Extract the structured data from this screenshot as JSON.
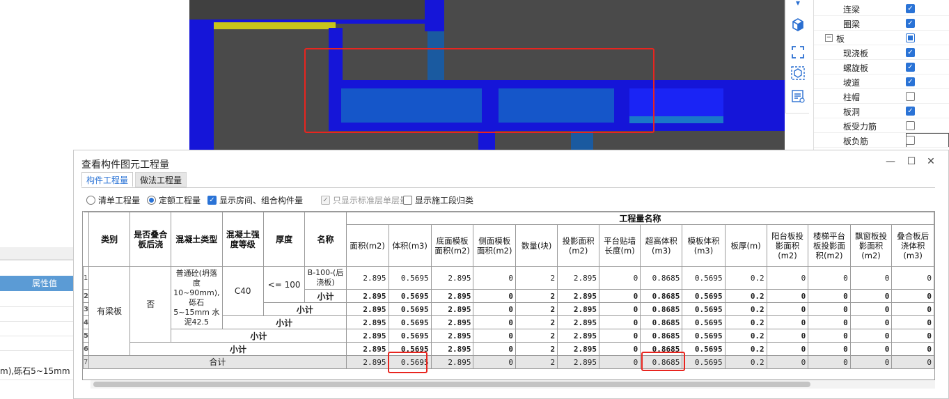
{
  "left_panel": {
    "prop_header": "属性值",
    "prop_value_text": "m),砾石5~15mm 2"
  },
  "toolstrip": {
    "icons": [
      "cube-icon",
      "select-box-icon",
      "view-3d-icon",
      "properties-icon"
    ]
  },
  "layer_tree": {
    "items": [
      {
        "label": "连梁",
        "checked": true,
        "indent": 2
      },
      {
        "label": "圈梁",
        "checked": true,
        "indent": 2
      },
      {
        "label": "板",
        "checked": "partial",
        "indent": 1,
        "toggle": "−"
      },
      {
        "label": "现浇板",
        "checked": true,
        "indent": 2
      },
      {
        "label": "螺旋板",
        "checked": true,
        "indent": 2
      },
      {
        "label": "坡道",
        "checked": true,
        "indent": 2
      },
      {
        "label": "柱帽",
        "checked": false,
        "indent": 2
      },
      {
        "label": "板洞",
        "checked": true,
        "indent": 2
      },
      {
        "label": "板受力筋",
        "checked": false,
        "indent": 2
      },
      {
        "label": "板负筋",
        "checked": false,
        "indent": 2
      }
    ]
  },
  "dialog": {
    "title": "查看构件图元工程量",
    "minimize": "—",
    "maximize": "☐",
    "close": "✕",
    "tabs": [
      {
        "label": "构件工程量",
        "active": true
      },
      {
        "label": "做法工程量",
        "active": false
      }
    ],
    "options": {
      "radio_qingdan": "清单工程量",
      "radio_dinge": "定额工程量",
      "cb_show_room": "显示房间、组合构件量",
      "cb_standard_floor": "只显示标准层单层量",
      "cb_construction_stage": "显示施工段归类"
    },
    "table": {
      "group_header": "工程量名称",
      "headers": {
        "category": "类别",
        "stacked": "是否叠合板后浇",
        "concrete_type": "混凝土类型",
        "strength": "混凝土强度等级",
        "thickness": "厚度",
        "name": "名称"
      },
      "qty_headers": [
        "面积(m2)",
        "体积(m3)",
        "底面模板面积(m2)",
        "侧面模板面积(m2)",
        "数量(块)",
        "投影面积(m2)",
        "平台贴墙长度(m)",
        "超高体积(m3)",
        "模板体积(m3)",
        "板厚(m)",
        "阳台板投影面积(m2)",
        "楼梯平台板投影面积(m2)",
        "飘窗板投影面积(m2)",
        "叠合板后浇体积(m3)"
      ],
      "category_value": "有梁板",
      "stacked_value": "否",
      "concrete_value": "普通砼(坍落度10~90mm),砾石5~15mm 水泥42.5",
      "strength_value": "C40",
      "thickness_value": "<= 100",
      "name_value": "B-100-(后浇板)",
      "subtotal_label": "小计",
      "total_label": "合计",
      "row_numbers": [
        "1",
        "2",
        "3",
        "4",
        "5",
        "6",
        "7"
      ],
      "values": [
        "2.895",
        "0.5695",
        "2.895",
        "0",
        "2",
        "2.895",
        "0",
        "0.8685",
        "0.5695",
        "0.2",
        "0",
        "0",
        "0",
        "0"
      ]
    }
  }
}
